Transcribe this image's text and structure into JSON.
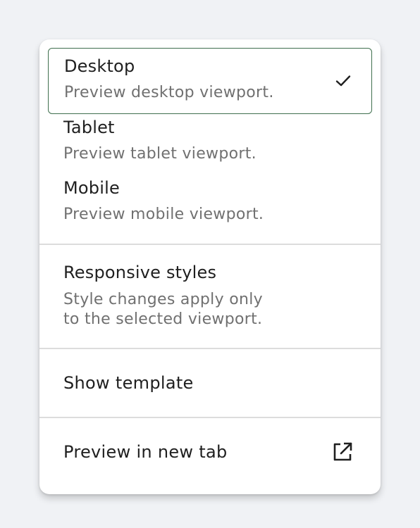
{
  "viewport_options": [
    {
      "label": "Desktop",
      "description": "Preview desktop viewport.",
      "selected": true
    },
    {
      "label": "Tablet",
      "description": "Preview tablet viewport.",
      "selected": false
    },
    {
      "label": "Mobile",
      "description": "Preview mobile viewport.",
      "selected": false
    }
  ],
  "responsive": {
    "label": "Responsive styles",
    "description_line1": "Style changes apply only",
    "description_line2": "to the selected viewport."
  },
  "actions": {
    "show_template": "Show template",
    "preview_new_tab": "Preview in new tab"
  },
  "icons": {
    "selected": "check-icon",
    "new_tab": "external-link-icon"
  },
  "colors": {
    "selected_border": "#3f6f4e",
    "primary_text": "#1f1f1f",
    "secondary_text": "#707070",
    "divider": "#dcdcdc",
    "background": "#f0f2f5"
  }
}
